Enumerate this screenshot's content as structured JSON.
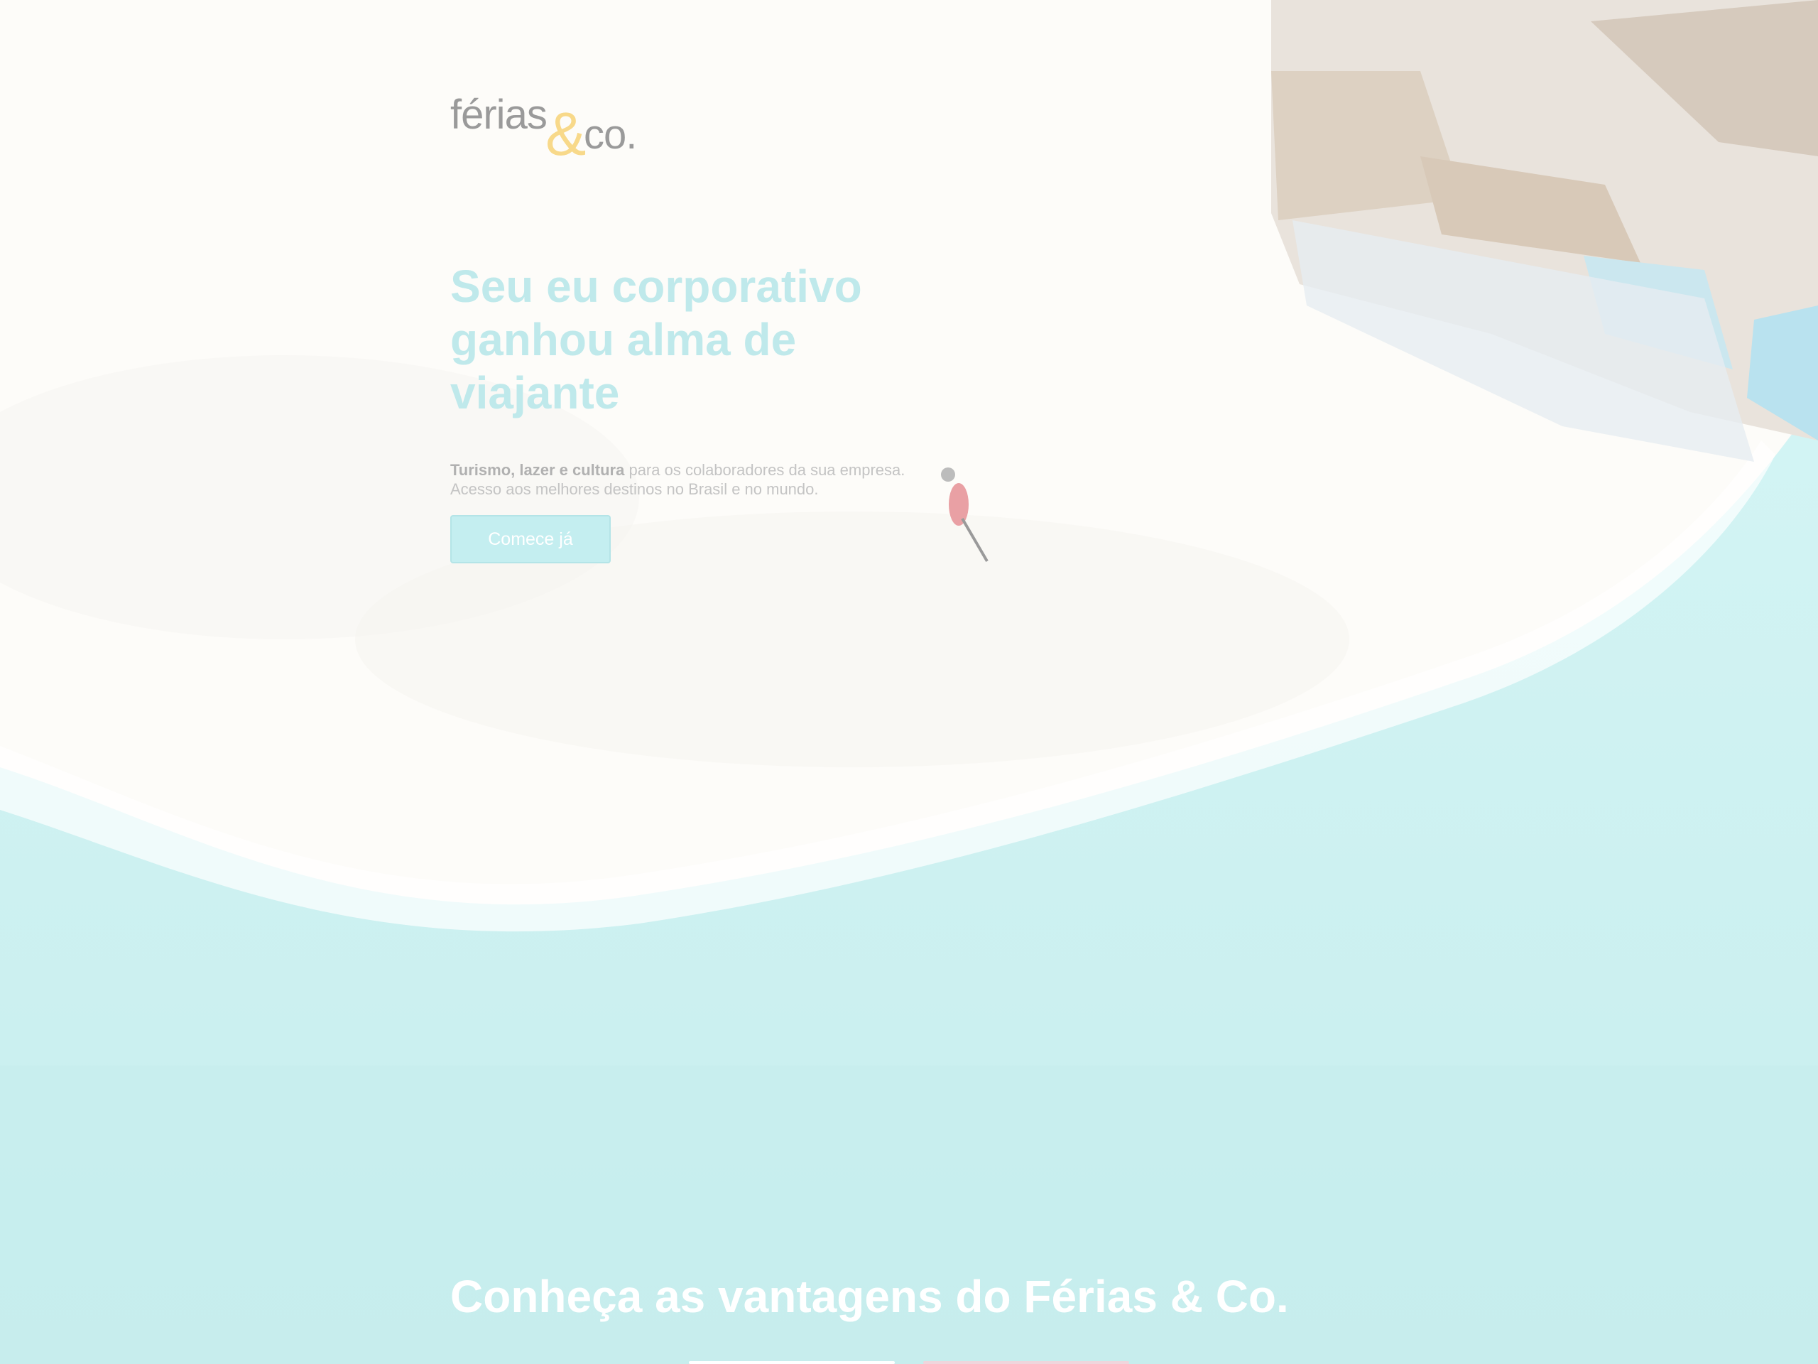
{
  "brand": {
    "logo_word": "férias",
    "logo_amp": "&",
    "logo_co": "co."
  },
  "hero": {
    "headline": "Seu eu corporativo ganhou alma de viajante",
    "sub_bold": "Turismo, lazer e cultura",
    "sub_rest": " para os colaboradores da sua empresa.",
    "sub_line2": "Acesso aos melhores destinos no Brasil e no mundo.",
    "cta_label": "Comece já"
  },
  "benefits": {
    "title": "Conheça as vantagens do Férias & Co."
  },
  "colors": {
    "accent": "#bfe9eb",
    "logo_amp": "#f8d98a",
    "sea": "#c9eff0",
    "sand": "#fdfcfa"
  }
}
